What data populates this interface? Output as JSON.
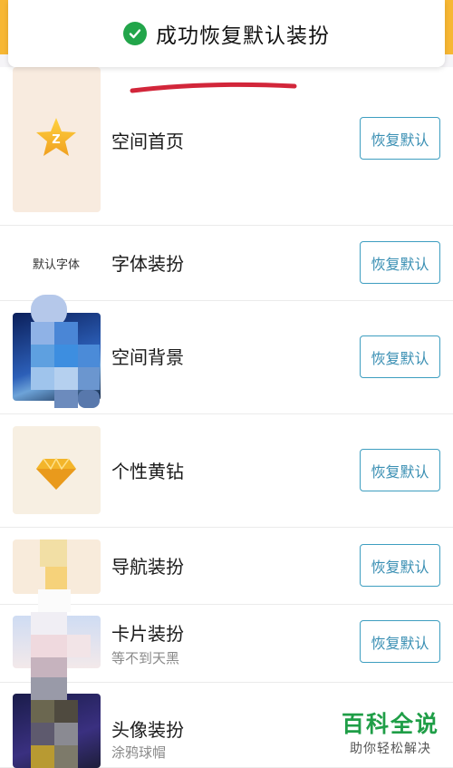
{
  "toast": {
    "message": "成功恢复默认装扮"
  },
  "items": [
    {
      "title": "空间首页",
      "subtitle": "",
      "button": "恢复默认"
    },
    {
      "title": "字体装扮",
      "subtitle": "",
      "button": "恢复默认",
      "thumb_text": "默认字体"
    },
    {
      "title": "空间背景",
      "subtitle": "",
      "button": "恢复默认"
    },
    {
      "title": "个性黄钻",
      "subtitle": "",
      "button": "恢复默认"
    },
    {
      "title": "导航装扮",
      "subtitle": "",
      "button": "恢复默认"
    },
    {
      "title": "卡片装扮",
      "subtitle": "等不到天黑",
      "button": "恢复默认"
    },
    {
      "title": "头像装扮",
      "subtitle": "涂鸦球帽",
      "button": ""
    }
  ],
  "watermark": {
    "main": "百科全说",
    "sub": "助你轻松解决"
  },
  "colors": {
    "accent": "#3a8fb3",
    "brand": "#f7b733",
    "success": "#22a54a",
    "watermark": "#1f9e47"
  }
}
